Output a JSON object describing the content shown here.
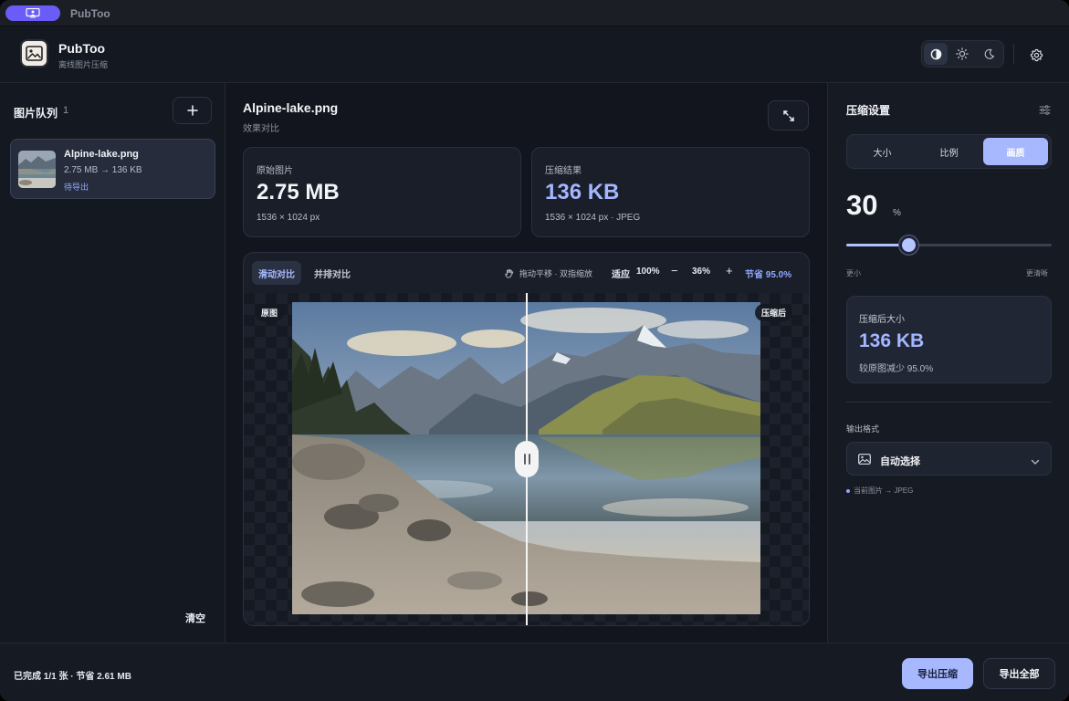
{
  "window": {
    "title": "PubToo"
  },
  "header": {
    "app_name": "PubToo",
    "app_subtitle": "离线图片压缩",
    "theme_options": [
      "auto-contrast-icon",
      "sun-icon",
      "moon-icon"
    ],
    "active_theme": 0
  },
  "queue": {
    "title": "图片队列",
    "count": "1",
    "items": [
      {
        "name": "Alpine-lake.png",
        "size": "2.75 MB → 136 KB",
        "status": "待导出"
      }
    ],
    "clear_label": "清空"
  },
  "preview": {
    "file_title": "Alpine-lake.png",
    "subtitle": "效果对比",
    "original": {
      "label": "原始图片",
      "size": "2.75 MB",
      "meta": "1536 × 1024 px"
    },
    "result": {
      "label": "压缩结果",
      "size": "136 KB",
      "meta": "1536 × 1024 px · JPEG"
    },
    "modes": [
      "滑动对比",
      "并排对比"
    ],
    "active_mode": 0,
    "hint": "拖动平移 · 双指缩放",
    "zoom_fit": "适应",
    "zoom_100": "100%",
    "zoom_minus": "−",
    "zoom_value": "36%",
    "zoom_plus": "+",
    "saving": "节省 95.0%",
    "badge_left": "原图",
    "badge_right": "压缩后",
    "split_fraction": 0.5
  },
  "settings": {
    "title": "压缩设置",
    "segments": [
      "大小",
      "比例",
      "画质"
    ],
    "active_segment": 2,
    "quality_value": "30",
    "quality_unit": "%",
    "quality_fraction": 0.3,
    "slider_min": "更小",
    "slider_max": "更清晰",
    "result_label": "压缩后大小",
    "result_value": "136 KB",
    "result_sub": "较原图减少 95.0%",
    "format_label": "输出格式",
    "format_value": "自动选择",
    "format_hint": "当前图片 → JPEG"
  },
  "footer": {
    "status": "已完成 1/1 张 · 节省 2.61 MB",
    "export_label": "导出压缩",
    "export_all_label": "导出全部"
  },
  "colors": {
    "accent": "#a7b8ff",
    "accent_text": "#a3b6ff",
    "titlebar_pill": "#6a5cf6"
  }
}
